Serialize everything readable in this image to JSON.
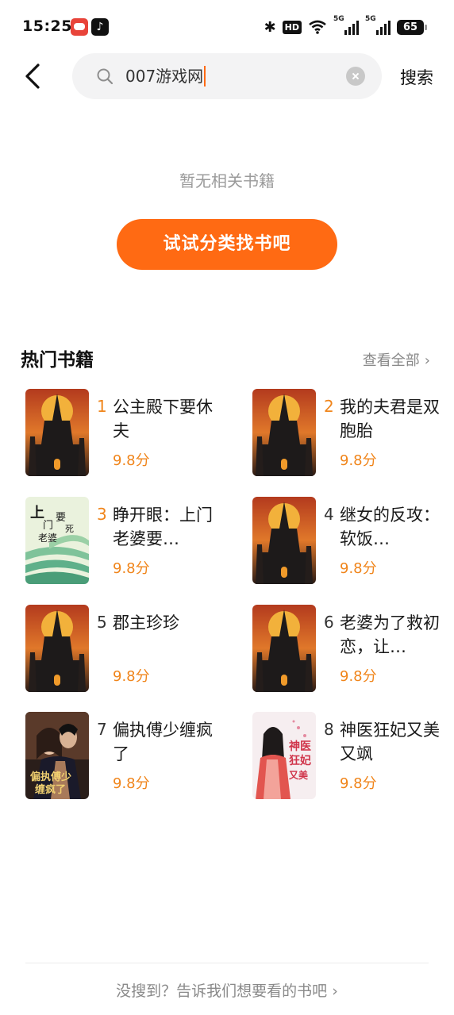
{
  "status_bar": {
    "time": "15:25",
    "hd_label": "HD",
    "net1": "5G",
    "net2": "5G",
    "battery": "65"
  },
  "search": {
    "query": "007游戏网",
    "submit_label": "搜索"
  },
  "empty_state": {
    "message": "暂无相关书籍",
    "button_label": "试试分类找书吧"
  },
  "hot_books": {
    "title": "热门书籍",
    "view_all_label": "查看全部",
    "items": [
      {
        "rank": "1",
        "title": "公主殿下要休夫",
        "score": "9.8分",
        "rank_color": "#f0851b",
        "cover": "castle-cover"
      },
      {
        "rank": "2",
        "title": "我的夫君是双胞胎",
        "score": "9.8分",
        "rank_color": "#f0851b",
        "cover": "castle-cover"
      },
      {
        "rank": "3",
        "title": "睁开眼：上门老婆要…",
        "score": "9.8分",
        "rank_color": "#f0851b",
        "cover": "terrace-cover"
      },
      {
        "rank": "4",
        "title": "继女的反攻：软饭…",
        "score": "9.8分",
        "rank_color": "#333333",
        "cover": "castle-cover"
      },
      {
        "rank": "5",
        "title": "郡主珍珍",
        "score": "9.8分",
        "rank_color": "#333333",
        "cover": "castle-cover"
      },
      {
        "rank": "6",
        "title": "老婆为了救初恋，让…",
        "score": "9.8分",
        "rank_color": "#333333",
        "cover": "castle-cover"
      },
      {
        "rank": "7",
        "title": "偏执傅少缠疯了",
        "score": "9.8分",
        "rank_color": "#333333",
        "cover": "romance-cover"
      },
      {
        "rank": "8",
        "title": "神医狂妃又美又飒",
        "score": "9.8分",
        "rank_color": "#333333",
        "cover": "ancient-cover"
      }
    ]
  },
  "footer": {
    "feedback_label": "没搜到？告诉我们想要看的书吧"
  },
  "colors": {
    "accent": "#ff6a13",
    "score": "#f0851b"
  }
}
